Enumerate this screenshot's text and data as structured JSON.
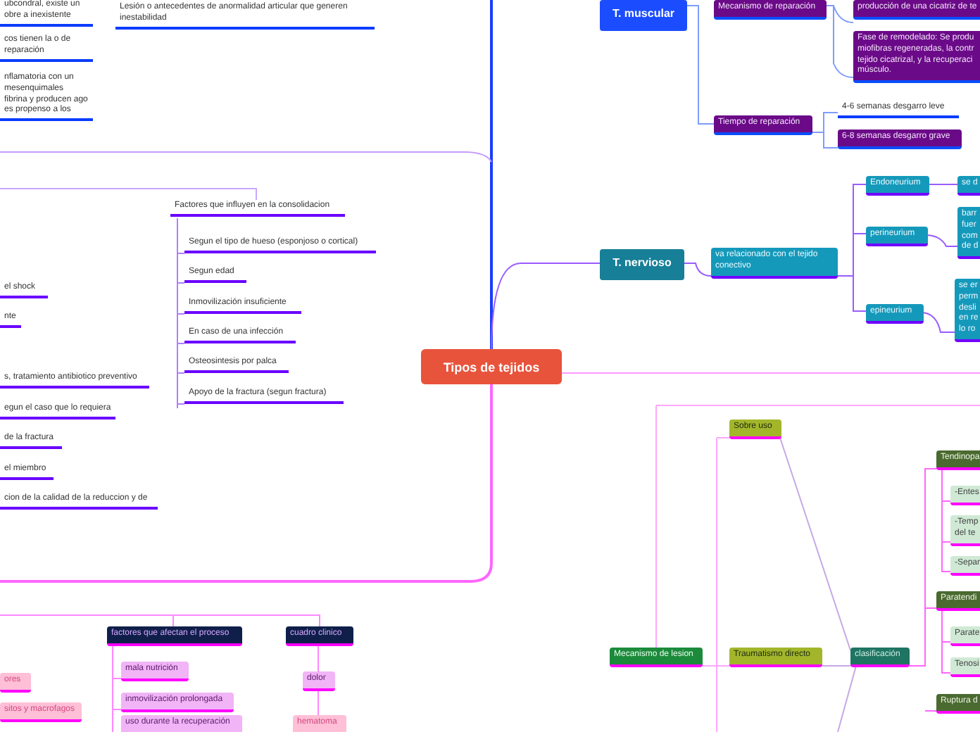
{
  "central": {
    "text": "Tipos de tejidos"
  },
  "nodes": [
    {
      "kind": "plain-blue",
      "text": "ubcondral, existe un obre a inexistente"
    },
    {
      "kind": "plain-blue",
      "text": "Lesión o antecedentes de anormalidad articular que generen inestabilidad"
    },
    {
      "kind": "plain-blue",
      "text": "cos tienen la o de reparación"
    },
    {
      "kind": "plain-blue",
      "text": "nflamatoria con un mesenquimales fibrina y producen ago es propenso a los"
    },
    {
      "kind": "plain-purple",
      "text": "Factores que influyen en la consolidacion"
    },
    {
      "kind": "plain-purple",
      "text": "Segun el tipo de hueso (esponjoso o cortical)"
    },
    {
      "kind": "plain-purple",
      "text": "Segun edad"
    },
    {
      "kind": "plain-purple",
      "text": "Inmovilización insuficiente"
    },
    {
      "kind": "plain-purple",
      "text": "En caso de una infección"
    },
    {
      "kind": "plain-purple",
      "text": "Osteosintesis por palca"
    },
    {
      "kind": "plain-purple",
      "text": "Apoyo de la fractura (segun fractura)"
    },
    {
      "kind": "plain-purple",
      "text": "el shock"
    },
    {
      "kind": "plain-purple",
      "text": "nte"
    },
    {
      "kind": "plain-purple",
      "text": "s, tratamiento antibiotico preventivo"
    },
    {
      "kind": "plain-purple",
      "text": "egun el caso que lo requiera"
    },
    {
      "kind": "plain-purple",
      "text": "de la fractura"
    },
    {
      "kind": "plain-purple",
      "text": "el miembro"
    },
    {
      "kind": "plain-purple",
      "text": "cion de la calidad de la reduccion y de"
    },
    {
      "kind": "navy",
      "text": "factores que afectan el proceso"
    },
    {
      "kind": "navy",
      "text": "cuadro clinico"
    },
    {
      "kind": "pink",
      "text": "ores"
    },
    {
      "kind": "pink",
      "text": "sitos y macrofagos"
    },
    {
      "kind": "lilac",
      "text": "mala nutrición"
    },
    {
      "kind": "lilac",
      "text": "inmovilización prolongada"
    },
    {
      "kind": "lilac",
      "text": "uso durante la recuperación"
    },
    {
      "kind": "lilac",
      "text": "dolor"
    },
    {
      "kind": "pink",
      "text": "hematoma"
    },
    {
      "kind": "muscular",
      "text": "T. muscular"
    },
    {
      "kind": "purple",
      "text": "Mecanismo de reparación"
    },
    {
      "kind": "purple",
      "text": "producción de una cicatriz de te"
    },
    {
      "kind": "purple",
      "text": "Fase de remodelado: Se produ miofibras regeneradas, la contr tejido cicatrizal, y la recuperaci músculo."
    },
    {
      "kind": "purple",
      "text": "Tiempo de reparación"
    },
    {
      "kind": "plain-blue",
      "text": "4-6 semanas desgarro leve"
    },
    {
      "kind": "purple",
      "text": "6-8 semanas desgarro grave"
    },
    {
      "kind": "nervous",
      "text": "T. nervioso"
    },
    {
      "kind": "teal",
      "text": "va relacionado con el tejido conectivo"
    },
    {
      "kind": "teal",
      "text": "Endoneurium"
    },
    {
      "kind": "teal",
      "text": "se d"
    },
    {
      "kind": "teal",
      "text": "perineurium"
    },
    {
      "kind": "teal",
      "text": "barr fuer com de d"
    },
    {
      "kind": "teal",
      "text": "epineurium"
    },
    {
      "kind": "teal",
      "text": "se er perm desli en re lo ro"
    },
    {
      "kind": "olive",
      "text": "Sobre uso"
    },
    {
      "kind": "green",
      "text": "Mecanismo de lesion"
    },
    {
      "kind": "olive",
      "text": "Traumatismo directo"
    },
    {
      "kind": "dark-teal",
      "text": "clasificación"
    },
    {
      "kind": "dark-green",
      "text": "Tendinopa"
    },
    {
      "kind": "light-green",
      "text": "-Entes"
    },
    {
      "kind": "light-green",
      "text": "-Temp del te"
    },
    {
      "kind": "light-green",
      "text": "-Separ"
    },
    {
      "kind": "dark-green",
      "text": "Paratendi"
    },
    {
      "kind": "light-green",
      "text": "Parate"
    },
    {
      "kind": "light-green",
      "text": "Tenosi"
    },
    {
      "kind": "dark-green",
      "text": "Ruptura d"
    }
  ]
}
